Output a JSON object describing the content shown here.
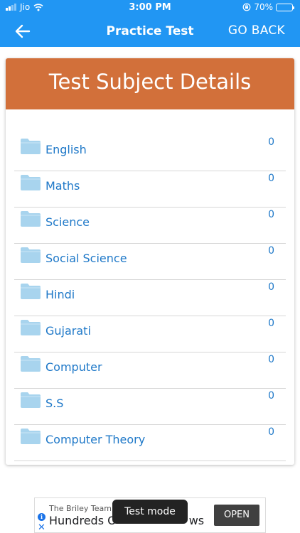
{
  "status_bar": {
    "carrier": "Jio",
    "time": "3:00 PM",
    "battery": "70%"
  },
  "top_bar": {
    "title": "Practice Test",
    "go_back_label": "GO BACK"
  },
  "card": {
    "title": "Test Subject Details",
    "header_color": "#d2703a"
  },
  "subjects": [
    {
      "name": "English",
      "count": "0"
    },
    {
      "name": "Maths",
      "count": "0"
    },
    {
      "name": "Science",
      "count": "0"
    },
    {
      "name": "Social Science",
      "count": "0"
    },
    {
      "name": "Hindi",
      "count": "0"
    },
    {
      "name": "Gujarati",
      "count": "0"
    },
    {
      "name": "Computer",
      "count": "0"
    },
    {
      "name": "S.S",
      "count": "0"
    },
    {
      "name": "Computer Theory",
      "count": "0"
    }
  ],
  "ad": {
    "sponsor": "The Briley Team",
    "headline": "Hundreds O",
    "headline_tail": "ws",
    "open_label": "OPEN"
  },
  "toast": {
    "text": "Test mode"
  },
  "colors": {
    "primary": "#2196f3",
    "header": "#d2703a",
    "link": "#1e78c8",
    "folder": "#a8d4ee"
  },
  "icons": {
    "back": "arrow-left-icon",
    "subject": "folder-icon",
    "ad_info": "info-icon",
    "ad_close": "close-icon"
  }
}
